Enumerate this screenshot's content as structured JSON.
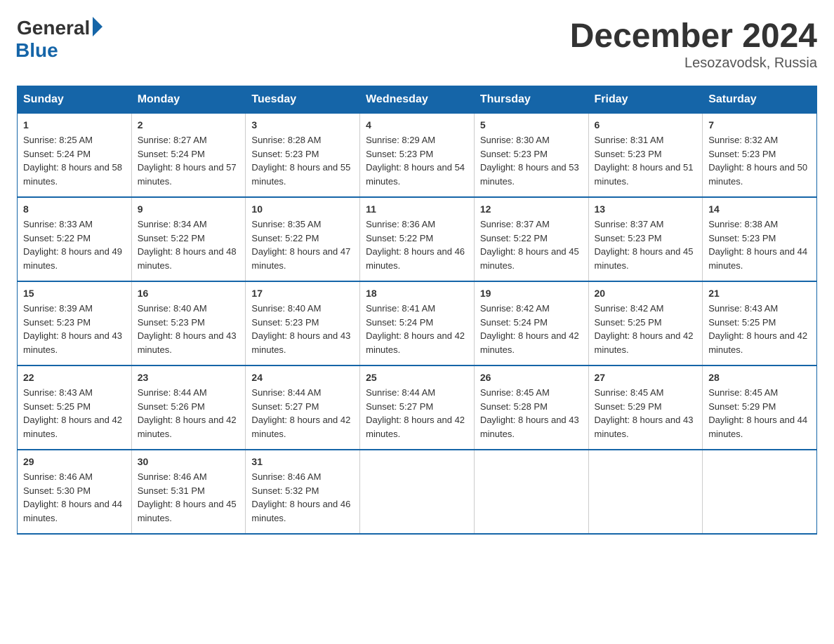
{
  "logo": {
    "general": "General",
    "blue": "Blue"
  },
  "title": "December 2024",
  "location": "Lesozavodsk, Russia",
  "headers": [
    "Sunday",
    "Monday",
    "Tuesday",
    "Wednesday",
    "Thursday",
    "Friday",
    "Saturday"
  ],
  "weeks": [
    [
      {
        "day": "1",
        "sunrise": "8:25 AM",
        "sunset": "5:24 PM",
        "daylight": "8 hours and 58 minutes."
      },
      {
        "day": "2",
        "sunrise": "8:27 AM",
        "sunset": "5:24 PM",
        "daylight": "8 hours and 57 minutes."
      },
      {
        "day": "3",
        "sunrise": "8:28 AM",
        "sunset": "5:23 PM",
        "daylight": "8 hours and 55 minutes."
      },
      {
        "day": "4",
        "sunrise": "8:29 AM",
        "sunset": "5:23 PM",
        "daylight": "8 hours and 54 minutes."
      },
      {
        "day": "5",
        "sunrise": "8:30 AM",
        "sunset": "5:23 PM",
        "daylight": "8 hours and 53 minutes."
      },
      {
        "day": "6",
        "sunrise": "8:31 AM",
        "sunset": "5:23 PM",
        "daylight": "8 hours and 51 minutes."
      },
      {
        "day": "7",
        "sunrise": "8:32 AM",
        "sunset": "5:23 PM",
        "daylight": "8 hours and 50 minutes."
      }
    ],
    [
      {
        "day": "8",
        "sunrise": "8:33 AM",
        "sunset": "5:22 PM",
        "daylight": "8 hours and 49 minutes."
      },
      {
        "day": "9",
        "sunrise": "8:34 AM",
        "sunset": "5:22 PM",
        "daylight": "8 hours and 48 minutes."
      },
      {
        "day": "10",
        "sunrise": "8:35 AM",
        "sunset": "5:22 PM",
        "daylight": "8 hours and 47 minutes."
      },
      {
        "day": "11",
        "sunrise": "8:36 AM",
        "sunset": "5:22 PM",
        "daylight": "8 hours and 46 minutes."
      },
      {
        "day": "12",
        "sunrise": "8:37 AM",
        "sunset": "5:22 PM",
        "daylight": "8 hours and 45 minutes."
      },
      {
        "day": "13",
        "sunrise": "8:37 AM",
        "sunset": "5:23 PM",
        "daylight": "8 hours and 45 minutes."
      },
      {
        "day": "14",
        "sunrise": "8:38 AM",
        "sunset": "5:23 PM",
        "daylight": "8 hours and 44 minutes."
      }
    ],
    [
      {
        "day": "15",
        "sunrise": "8:39 AM",
        "sunset": "5:23 PM",
        "daylight": "8 hours and 43 minutes."
      },
      {
        "day": "16",
        "sunrise": "8:40 AM",
        "sunset": "5:23 PM",
        "daylight": "8 hours and 43 minutes."
      },
      {
        "day": "17",
        "sunrise": "8:40 AM",
        "sunset": "5:23 PM",
        "daylight": "8 hours and 43 minutes."
      },
      {
        "day": "18",
        "sunrise": "8:41 AM",
        "sunset": "5:24 PM",
        "daylight": "8 hours and 42 minutes."
      },
      {
        "day": "19",
        "sunrise": "8:42 AM",
        "sunset": "5:24 PM",
        "daylight": "8 hours and 42 minutes."
      },
      {
        "day": "20",
        "sunrise": "8:42 AM",
        "sunset": "5:25 PM",
        "daylight": "8 hours and 42 minutes."
      },
      {
        "day": "21",
        "sunrise": "8:43 AM",
        "sunset": "5:25 PM",
        "daylight": "8 hours and 42 minutes."
      }
    ],
    [
      {
        "day": "22",
        "sunrise": "8:43 AM",
        "sunset": "5:25 PM",
        "daylight": "8 hours and 42 minutes."
      },
      {
        "day": "23",
        "sunrise": "8:44 AM",
        "sunset": "5:26 PM",
        "daylight": "8 hours and 42 minutes."
      },
      {
        "day": "24",
        "sunrise": "8:44 AM",
        "sunset": "5:27 PM",
        "daylight": "8 hours and 42 minutes."
      },
      {
        "day": "25",
        "sunrise": "8:44 AM",
        "sunset": "5:27 PM",
        "daylight": "8 hours and 42 minutes."
      },
      {
        "day": "26",
        "sunrise": "8:45 AM",
        "sunset": "5:28 PM",
        "daylight": "8 hours and 43 minutes."
      },
      {
        "day": "27",
        "sunrise": "8:45 AM",
        "sunset": "5:29 PM",
        "daylight": "8 hours and 43 minutes."
      },
      {
        "day": "28",
        "sunrise": "8:45 AM",
        "sunset": "5:29 PM",
        "daylight": "8 hours and 44 minutes."
      }
    ],
    [
      {
        "day": "29",
        "sunrise": "8:46 AM",
        "sunset": "5:30 PM",
        "daylight": "8 hours and 44 minutes."
      },
      {
        "day": "30",
        "sunrise": "8:46 AM",
        "sunset": "5:31 PM",
        "daylight": "8 hours and 45 minutes."
      },
      {
        "day": "31",
        "sunrise": "8:46 AM",
        "sunset": "5:32 PM",
        "daylight": "8 hours and 46 minutes."
      },
      null,
      null,
      null,
      null
    ]
  ]
}
